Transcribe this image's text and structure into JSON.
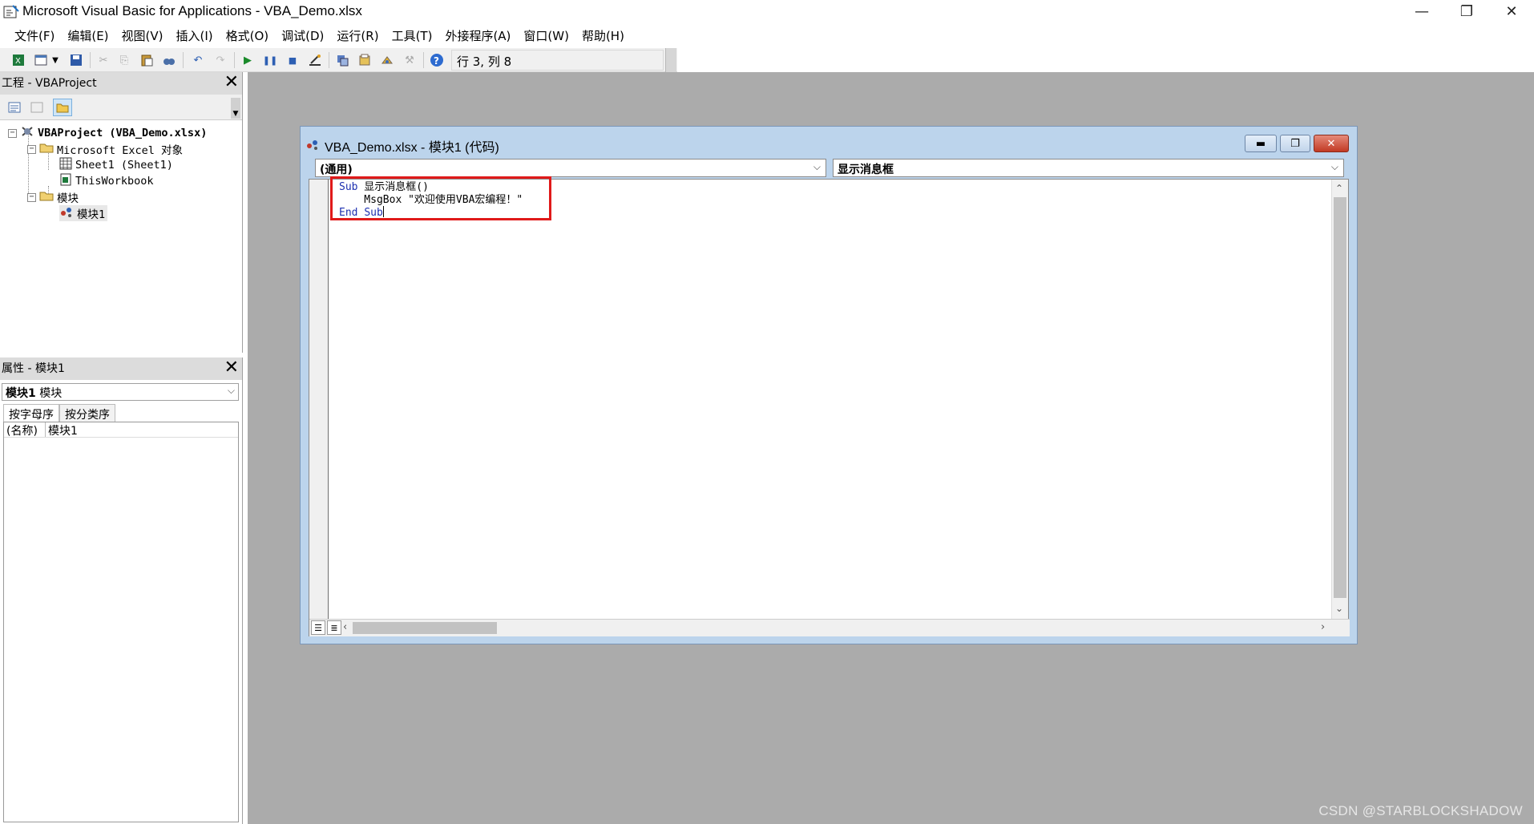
{
  "window": {
    "title": "Microsoft Visual Basic for Applications - VBA_Demo.xlsx",
    "minimize_glyph": "—",
    "restore_glyph": "❐",
    "close_glyph": "✕"
  },
  "menubar": {
    "items": [
      "文件(F)",
      "编辑(E)",
      "视图(V)",
      "插入(I)",
      "格式(O)",
      "调试(D)",
      "运行(R)",
      "工具(T)",
      "外接程序(A)",
      "窗口(W)",
      "帮助(H)"
    ]
  },
  "toolbar": {
    "cursor_position": "行 3, 列 8",
    "icons": [
      "excel-icon",
      "insert-userform-icon",
      "save-icon",
      "cut-icon",
      "copy-icon",
      "paste-icon",
      "find-icon",
      "undo-icon",
      "redo-icon",
      "run-icon",
      "break-icon",
      "reset-icon",
      "design-mode-icon",
      "project-explorer-icon",
      "properties-icon",
      "object-browser-icon",
      "toolbox-icon",
      "help-icon"
    ]
  },
  "project_pane": {
    "title": "工程 - VBAProject",
    "tree": [
      {
        "label": "VBAProject (VBA_Demo.xlsx)",
        "level": 0
      },
      {
        "label": "Microsoft Excel 对象",
        "level": 1
      },
      {
        "label": "Sheet1 (Sheet1)",
        "level": 2
      },
      {
        "label": "ThisWorkbook",
        "level": 2
      },
      {
        "label": "模块",
        "level": 1
      },
      {
        "label": "模块1",
        "level": 2
      }
    ]
  },
  "properties_pane": {
    "title": "属性 - 模块1",
    "object_name": "模块1",
    "object_type": "模块",
    "tabs": [
      "按字母序",
      "按分类序"
    ],
    "rows": [
      {
        "key": "(名称)",
        "value": "模块1"
      }
    ]
  },
  "code_window": {
    "title": "VBA_Demo.xlsx - 模块1 (代码)",
    "object_combo": "(通用)",
    "procedure_combo": "显示消息框",
    "code": {
      "line1_kw": "Sub",
      "line1_rest": " 显示消息框()",
      "line2": "    MsgBox \"欢迎使用VBA宏编程！\"",
      "line3_kw1": "End",
      "line3_kw2": "Sub"
    }
  },
  "watermark": "CSDN @STARBLOCKSHADOW"
}
